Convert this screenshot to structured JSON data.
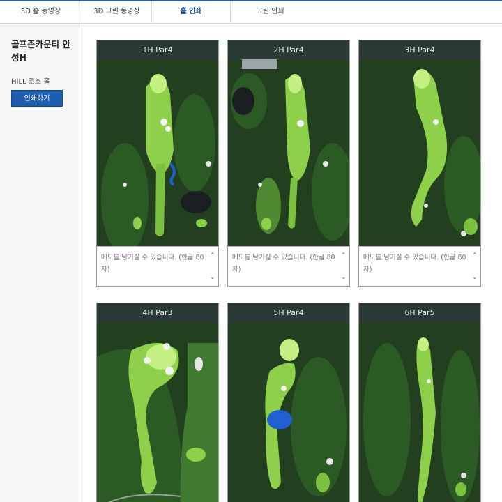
{
  "tabs": [
    {
      "label": "3D 홀 동영상"
    },
    {
      "label": "3D 그린 동영상"
    },
    {
      "label": "홀 인쇄"
    },
    {
      "label": "그린 인쇄"
    }
  ],
  "sidebar": {
    "course_title": "골프존카운티 안성H",
    "course_sub": "HILL 코스 홀",
    "print_label": "인쇄하기"
  },
  "holes": [
    {
      "label": "1H Par4",
      "memo_placeholder": "메모를 남기실 수 있습니다. (한글 80자)"
    },
    {
      "label": "2H Par4",
      "memo_placeholder": "메모를 남기실 수 있습니다. (한글 80자)"
    },
    {
      "label": "3H Par4",
      "memo_placeholder": "메모를 남기실 수 있습니다. (한글 80자)"
    },
    {
      "label": "4H Par3",
      "memo_placeholder": ""
    },
    {
      "label": "5H Par4",
      "memo_placeholder": ""
    },
    {
      "label": "6H Par5",
      "memo_placeholder": ""
    }
  ],
  "colors": {
    "accent": "#1c5db0",
    "card_header": "#2b3a36",
    "forest": "#1f3a1c",
    "fairway": "#8fd04a",
    "green": "#c4ef82",
    "water": "#1f5fd0"
  }
}
